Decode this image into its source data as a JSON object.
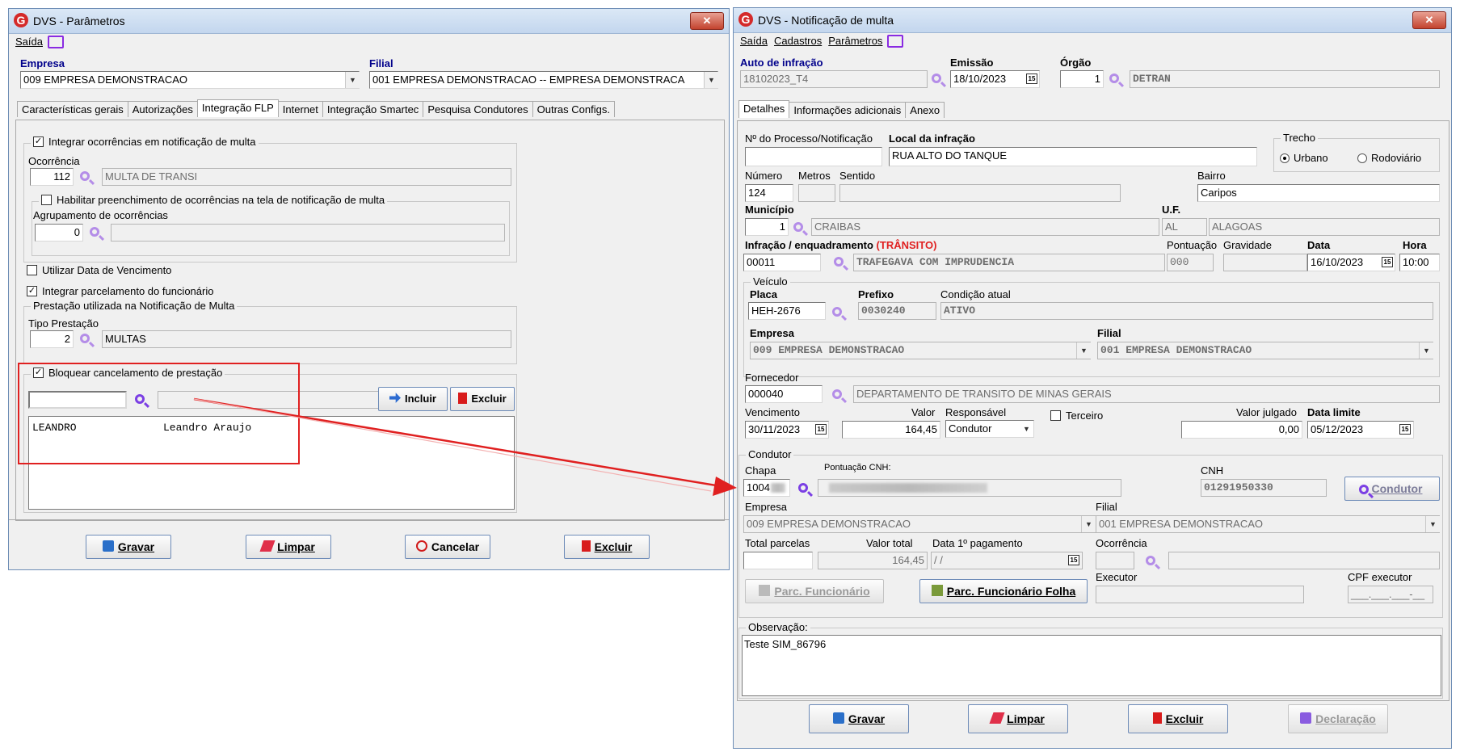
{
  "left_window": {
    "title": "DVS - Parâmetros",
    "close_label": "✕",
    "menu": {
      "saida": "Saída"
    },
    "empresa_label": "Empresa",
    "empresa_value": "009 EMPRESA DEMONSTRACAO",
    "filial_label": "Filial",
    "filial_value": "001 EMPRESA DEMONSTRACAO -- EMPRESA DEMONSTRACA",
    "tabs": [
      "Características gerais",
      "Autorizações",
      "Integração FLP",
      "Internet",
      "Integração Smartec",
      "Pesquisa Condutores",
      "Outras Configs."
    ],
    "integrar_ocorrencias_label": "Integrar ocorrências em notificação de multa",
    "ocorrencia_label": "Ocorrência",
    "ocorrencia_code": "112",
    "ocorrencia_desc": "MULTA DE TRANSI",
    "habilitar_label": "Habilitar preenchimento de ocorrências na tela de notificação de multa",
    "agrupamento_label": "Agrupamento de ocorrências",
    "agrupamento_code": "0",
    "utilizar_data_label": "Utilizar Data de Vencimento",
    "integrar_parcelamento_label": "Integrar parcelamento do funcionário",
    "prestacao_group_label": "Prestação utilizada na Notificação de Multa",
    "tipo_prestacao_label": "Tipo Prestação",
    "tipo_prestacao_code": "2",
    "tipo_prestacao_desc": "MULTAS",
    "bloquear_label": "Bloquear cancelamento de prestação",
    "incluir_label": "Incluir",
    "excluir_small_label": "Excluir",
    "list_row_user": "LEANDRO",
    "list_row_name": "Leandro Araujo",
    "buttons": {
      "gravar": "Gravar",
      "limpar": "Limpar",
      "cancelar": "Cancelar",
      "excluir": "Excluir"
    }
  },
  "right_window": {
    "title": "DVS - Notificação de multa",
    "close_label": "✕",
    "menu": {
      "saida": "Saída",
      "cadastros": "Cadastros",
      "parametros": "Parâmetros"
    },
    "auto_label": "Auto de infração",
    "auto_value": "18102023_T4",
    "emissao_label": "Emissão",
    "emissao_value": "18/10/2023",
    "orgao_label": "Órgão",
    "orgao_code": "1",
    "orgao_desc": "DETRAN",
    "tabs": [
      "Detalhes",
      "Informações adicionais",
      "Anexo"
    ],
    "processo_label": "Nº do Processo/Notificação",
    "local_label": "Local da infração",
    "local_value": "RUA  ALTO DO TANQUE",
    "trecho_label": "Trecho",
    "urbano_label": "Urbano",
    "rodoviario_label": "Rodoviário",
    "numero_label": "Número",
    "numero_value": "124",
    "metros_label": "Metros",
    "sentido_label": "Sentido",
    "bairro_label": "Bairro",
    "bairro_value": "Caripos",
    "municipio_label": "Município",
    "municipio_code": "1",
    "municipio_desc": "CRAIBAS",
    "uf_label": "U.F.",
    "uf_code": "AL",
    "uf_desc": "ALAGOAS",
    "infracao_label": "Infração / enquadramento",
    "infracao_tag": "(TRÂNSITO)",
    "infracao_code": "00011",
    "infracao_desc": "TRAFEGAVA COM IMPRUDENCIA",
    "pontuacao_label": "Pontuação",
    "pontuacao_value": "000",
    "gravidade_label": "Gravidade",
    "data_label": "Data",
    "data_value": "16/10/2023",
    "hora_label": "Hora",
    "hora_value": "10:00",
    "veiculo_label": "Veículo",
    "placa_label": "Placa",
    "placa_value": "HEH-2676",
    "prefixo_label": "Prefixo",
    "prefixo_value": "0030240",
    "condicao_label": "Condição atual",
    "condicao_value": "ATIVO",
    "v_empresa_label": "Empresa",
    "v_empresa_value": "009 EMPRESA DEMONSTRACAO",
    "v_filial_label": "Filial",
    "v_filial_value": "001 EMPRESA DEMONSTRACAO",
    "fornecedor_label": "Fornecedor",
    "fornecedor_code": "000040",
    "fornecedor_desc": "DEPARTAMENTO DE TRANSITO DE MINAS GERAIS",
    "vencimento_label": "Vencimento",
    "vencimento_value": "30/11/2023",
    "valor_label": "Valor",
    "valor_value": "164,45",
    "responsavel_label": "Responsável",
    "responsavel_value": "Condutor",
    "terceiro_label": "Terceiro",
    "valor_julgado_label": "Valor julgado",
    "valor_julgado_value": "0,00",
    "data_limite_label": "Data limite",
    "data_limite_value": "05/12/2023",
    "condutor_group_label": "Condutor",
    "chapa_label": "Chapa",
    "chapa_value": "1004",
    "pontuacao_cnh_label": "Pontuação CNH:",
    "cnh_label": "CNH",
    "cnh_value": "01291950330",
    "condutor_button": "Condutor",
    "c_empresa_label": "Empresa",
    "c_empresa_value": "009 EMPRESA DEMONSTRACAO",
    "c_filial_label": "Filial",
    "c_filial_value": "001 EMPRESA DEMONSTRACAO",
    "total_parcelas_label": "Total parcelas",
    "valor_total_label": "Valor total",
    "valor_total_value": "164,45",
    "data_pagamento_label": "Data 1º pagamento",
    "data_pagamento_value": " / /",
    "ocorrencia_label": "Ocorrência",
    "parc_funcionario_label": "Parc. Funcionário",
    "parc_folha_label": "Parc. Funcionário Folha",
    "executor_label": "Executor",
    "cpf_executor_label": "CPF executor",
    "cpf_executor_value": "___.___.___-__",
    "observacao_label": "Observação:",
    "observacao_value": "Teste SIM_86796",
    "buttons": {
      "gravar": "Gravar",
      "limpar": "Limpar",
      "excluir": "Excluir",
      "declaracao": "Declaração"
    }
  },
  "colors": {
    "highlight_red": "#e02020",
    "title_red": "#d42a2a",
    "navy": "#00008b",
    "magnifier": "#7b3fe4"
  }
}
